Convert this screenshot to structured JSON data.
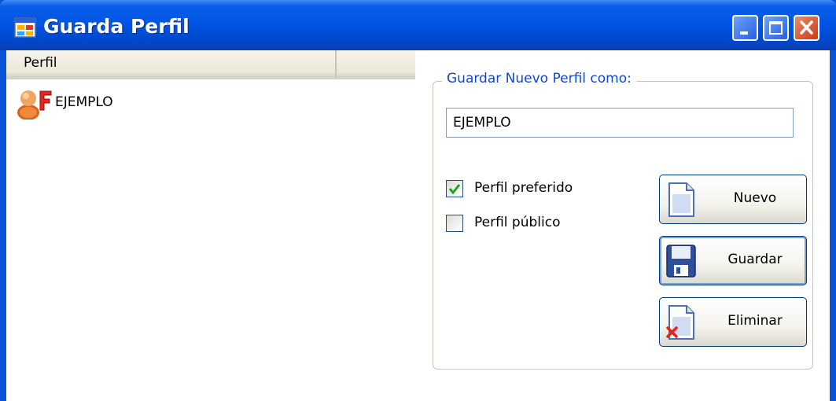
{
  "window": {
    "title": "Guarda Perfil"
  },
  "list": {
    "columns": [
      "Perfil"
    ],
    "items": [
      {
        "label": "EJEMPLO",
        "icon": "user-profile-icon"
      }
    ]
  },
  "form": {
    "group_label": "Guardar Nuevo Perfil como:",
    "name_value": "EJEMPLO",
    "checkbox_preferido": {
      "label": "Perfil preferido",
      "checked": true
    },
    "checkbox_publico": {
      "label": "Perfil público",
      "checked": false
    }
  },
  "buttons": {
    "nuevo": "Nuevo",
    "guardar": "Guardar",
    "eliminar": "Eliminar"
  },
  "colors": {
    "titlebar": "#0055e5",
    "group_label": "#0e46d6",
    "check_mark": "#21a121",
    "close_button": "#cc3a12"
  }
}
